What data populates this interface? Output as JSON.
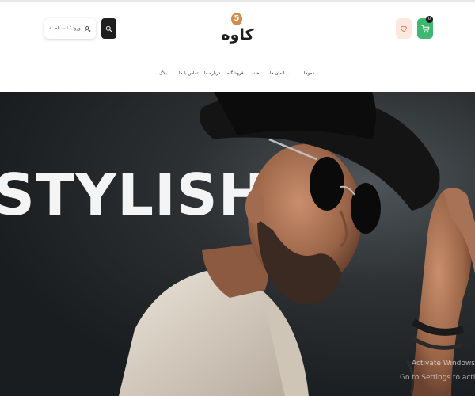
{
  "header": {
    "cart_count": "0",
    "logo_number": "5",
    "logo_text": "کاوه",
    "login_label": "ورود / ثبت نام",
    "colors": {
      "cart": "#3fb771",
      "wishlist": "#fde8df",
      "logo_accent": "#d28b4c",
      "search": "#1e1e1e"
    }
  },
  "nav": {
    "items": [
      {
        "label": "دموها",
        "has_caret": true
      },
      {
        "label": "المان ها",
        "has_caret": true
      },
      {
        "label": "خانه",
        "has_caret": false
      },
      {
        "label": "فروشگاه",
        "has_caret": false
      },
      {
        "label": "درباره ما",
        "has_caret": false
      },
      {
        "label": "تماس با ما",
        "has_caret": false
      },
      {
        "label": "بلاگ",
        "has_caret": false
      }
    ]
  },
  "hero": {
    "headline": "STYLISH",
    "watermark_line1": "Activate Windows",
    "watermark_line2": "Go to Settings to activate Windows."
  }
}
